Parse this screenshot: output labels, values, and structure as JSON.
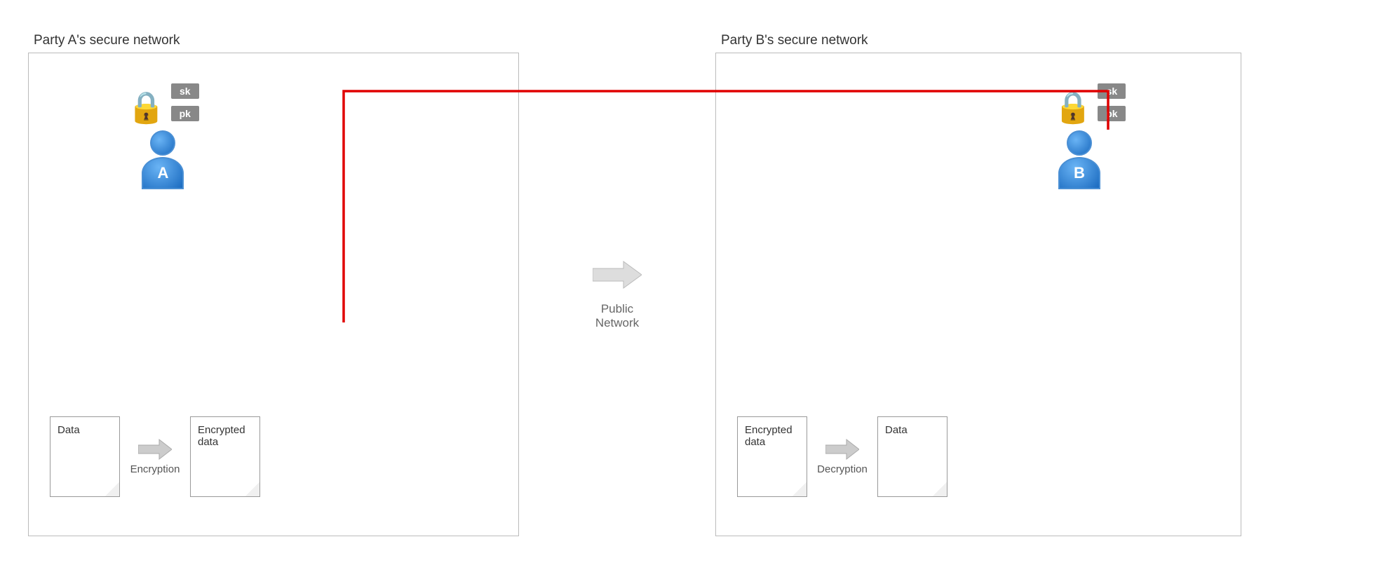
{
  "partyA": {
    "network_label": "Party A's secure network",
    "sk_label": "sk",
    "pk_label": "pk",
    "avatar_label": "A",
    "data_doc_label": "Data",
    "encrypted_doc_label": "Encrypted\ndata",
    "encryption_label": "Encryption"
  },
  "partyB": {
    "network_label": "Party B's secure network",
    "sk_label": "sk",
    "pk_label": "pk",
    "avatar_label": "B",
    "encrypted_doc_label": "Encrypted\ndata",
    "data_doc_label": "Data",
    "decryption_label": "Decryption"
  },
  "publicNetwork": {
    "label_line1": "Public",
    "label_line2": "Network"
  },
  "colors": {
    "red_wire": "#e00000",
    "box_border": "#aaa",
    "key_badge_bg": "#888",
    "doc_border": "#999",
    "arrow_color": "#ccc"
  }
}
